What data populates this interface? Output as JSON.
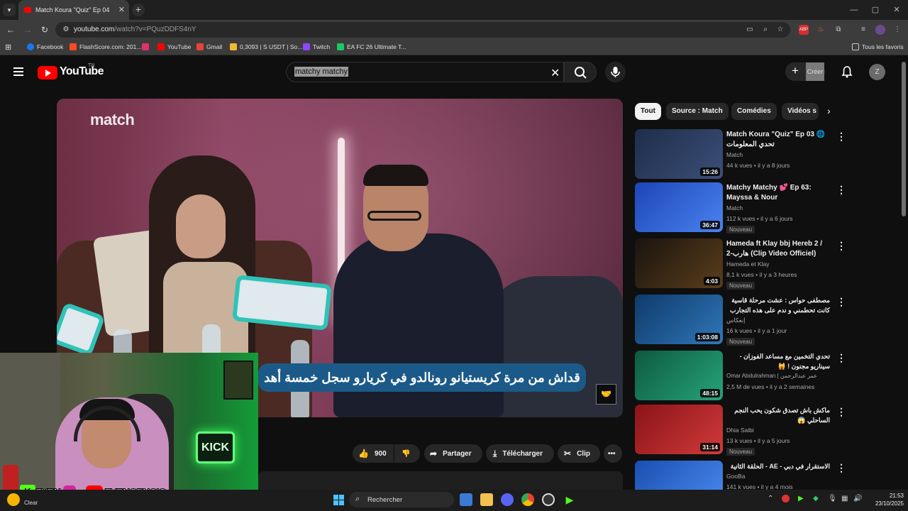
{
  "browser": {
    "tab_title": "Match Koura \"Quiz\" Ep 04",
    "url_main": "youtube.com",
    "url_rest": "/watch?v=PQuzDDFS4nY",
    "bookmarks": [
      {
        "label": "Facebook",
        "color": "#1877f2"
      },
      {
        "label": "FlashScore.com: 201...",
        "color": "#ff4b1f"
      },
      {
        "label": "",
        "color": "#e1306c"
      },
      {
        "label": "YouTube",
        "color": "#ff0000"
      },
      {
        "label": "Gmail",
        "color": "#ea4335"
      },
      {
        "label": "0,3093 | S USDT | So...",
        "color": "#f3ba2f"
      },
      {
        "label": "Twitch",
        "color": "#9146ff"
      },
      {
        "label": "EA FC 26 Ultimate T...",
        "color": "#18c964"
      }
    ],
    "all_bookmarks": "Tous les favoris"
  },
  "youtube": {
    "logo": "YouTube",
    "country": "TN",
    "search_value": "matchy matchy",
    "create_label": "Créer",
    "avatar_letter": "Z"
  },
  "video": {
    "channel_watermark": "match",
    "subtitle": "قداش من مرة كريستيانو رونالدو في كريارو سجل خمسة أهد",
    "likes": "900",
    "share": "Partager",
    "download": "Télécharger",
    "clip": "Clip"
  },
  "chips": [
    "Tout",
    "Source : Match",
    "Comédies",
    "Vidéos s"
  ],
  "recommendations": [
    {
      "title": "Match Koura \"Quiz\" Ep 03 🌐 تحدي المعلومات",
      "channel": "Match",
      "meta": "44 k vues • il y a 8 jours",
      "duration": "15:26",
      "badge": "",
      "thumb_color": "#2b3a5a"
    },
    {
      "title": "Matchy Matchy 💕 Ep 63: Mayssa & Nour",
      "channel": "Match",
      "meta": "112 k vues • il y a 6 jours",
      "duration": "36:47",
      "badge": "Nouveau",
      "thumb_color": "#2750c9"
    },
    {
      "title": "Hameda ft Klay bbj Hereb 2 / هارب-2 (Clip Video Officiel)",
      "channel": "Hameda et Klay",
      "meta": "8,1 k vues • il y a 3 heures",
      "duration": "4:03",
      "badge": "Nouveau",
      "thumb_color": "#3a2a1a"
    },
    {
      "title": "مصطفى حواس : عشت مرحلة قاسية كانت تحطمني و ندم على هذه التجارب",
      "channel": "إنعكاس",
      "meta": "16 k vues • il y a 1 jour",
      "duration": "1:03:08",
      "badge": "Nouveau",
      "thumb_color": "#1d4a7a"
    },
    {
      "title": "تحدي التخمين مع مساعد الفوزان - سيناريو مجنون ! 🙀",
      "channel": "Omar Abdulrahman | عمر عبدالرحمن",
      "meta": "2,5 M de vues • il y a 2 semaines",
      "duration": "48:15",
      "badge": "",
      "thumb_color": "#1b7a5a"
    },
    {
      "title": "ماكش باش تصدق شكون يحب النجم الساحلي 😱",
      "channel": "Dhia Saibi",
      "meta": "13 k vues • il y a 5 jours",
      "duration": "31:14",
      "badge": "Nouveau",
      "thumb_color": "#b0252a"
    },
    {
      "title": "الاستقرار في دبي - AE - الحلقة الثانية",
      "channel": "GooBa",
      "meta": "141 k vues • il y a 4 mois",
      "duration": "",
      "badge": "",
      "thumb_color": "#2a6bd0"
    }
  ],
  "overlay": {
    "name1": "ZVEN",
    "name2": "ZVENCENCIO",
    "kick": "KICK",
    "weather": "Clear"
  },
  "taskbar": {
    "search_placeholder": "Rechercher",
    "time": "21:53",
    "date": "23/10/2025"
  }
}
